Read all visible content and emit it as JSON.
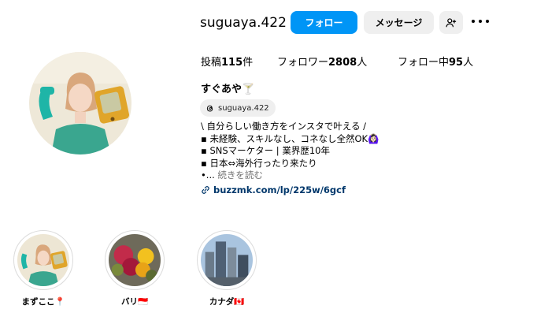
{
  "profile": {
    "username": "suguaya.422",
    "display_name": "すぐあや🍸",
    "threads_handle": "suguaya.422",
    "follow_label": "フォロー",
    "message_label": "メッセージ"
  },
  "stats": {
    "posts_label": "投稿",
    "posts_count": "115",
    "posts_unit": "件",
    "followers_label": "フォロワー",
    "followers_count": "2808",
    "followers_unit": "人",
    "following_label": "フォロー中",
    "following_count": "95",
    "following_unit": "人"
  },
  "bio": {
    "lines": [
      "\\ 自分らしい働き方をインスタで叶える /",
      "▪ 未経験、スキルなし、コネなし全然OK🙆🏻‍♀️",
      "▪ SNSマーケター | 業界歴10年",
      "▪ 日本⇔海外行ったり来たり"
    ],
    "more_prefix": "•...",
    "more_label": " 続きを読む",
    "link": "buzzmk.com/lp/225w/6gcf"
  },
  "highlights": [
    {
      "label": "まずここ📍"
    },
    {
      "label": "バリ🇮🇩"
    },
    {
      "label": "カナダ🇨🇦"
    }
  ],
  "colors": {
    "primary": "#0095f6",
    "secondary_button": "#efefef",
    "link": "#00376b",
    "muted": "#737373"
  }
}
